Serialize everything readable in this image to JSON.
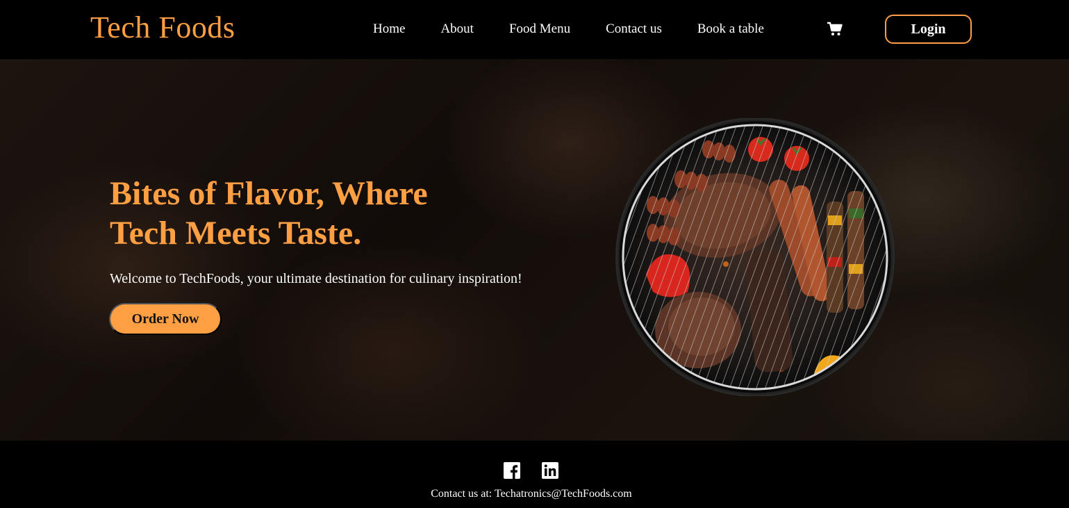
{
  "navbar": {
    "brand": "Tech Foods",
    "links": [
      "Home",
      "About",
      "Food Menu",
      "Contact us",
      "Book a table"
    ],
    "cart_icon": "shopping-cart-icon",
    "login_label": "Login",
    "accent_color": "#ff9f43"
  },
  "hero": {
    "title_line1": "Bites of Flavor, Where",
    "title_line2": "Tech Meets Taste.",
    "subtitle": "Welcome to TechFoods, your ultimate destination for culinary inspiration!",
    "cta_label": "Order Now",
    "image": "grill-with-meats-image"
  },
  "footer": {
    "social_icons": [
      "facebook-icon",
      "linkedin-icon"
    ],
    "contact_prefix": "Contact us at:",
    "contact_email": "Techatronics@TechFoods.com"
  }
}
